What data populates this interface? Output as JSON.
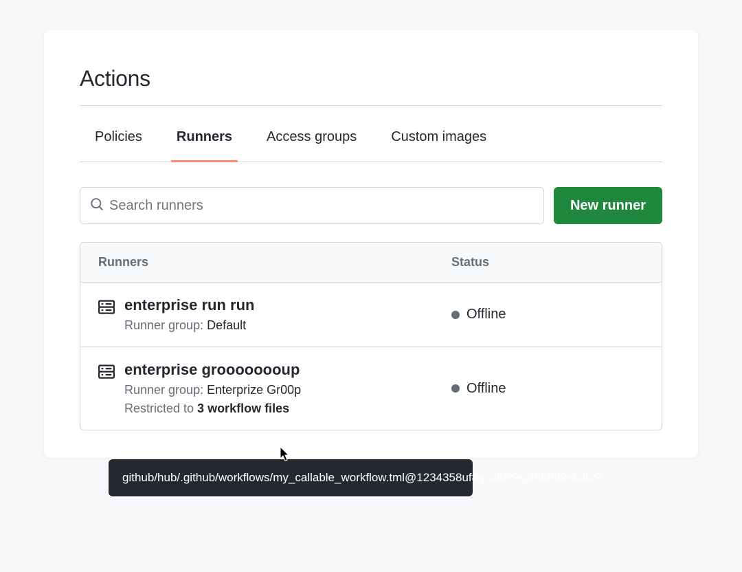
{
  "page": {
    "title": "Actions"
  },
  "tabs": [
    {
      "label": "Policies"
    },
    {
      "label": "Runners"
    },
    {
      "label": "Access groups"
    },
    {
      "label": "Custom images"
    }
  ],
  "active_tab_index": 1,
  "search": {
    "placeholder": "Search runners"
  },
  "buttons": {
    "new_runner": "New runner"
  },
  "table": {
    "headers": {
      "runners": "Runners",
      "status": "Status"
    },
    "group_prefix": "Runner group: ",
    "restricted_prefix": "Restricted to ",
    "restricted_suffix": " workflow files",
    "rows": [
      {
        "name": "enterprise run run",
        "group": "Default",
        "status": "Offline"
      },
      {
        "name": "enterprise groooooooup",
        "group": "Enterprize Gr00p",
        "restricted_count": "3",
        "status": "Offline"
      }
    ]
  },
  "tooltip": {
    "text": "github/hub/.github/workflows/my_callable_workflow.tml@1234358uf8gjs8d99sjd8fd8f9s8dfu9,..."
  }
}
